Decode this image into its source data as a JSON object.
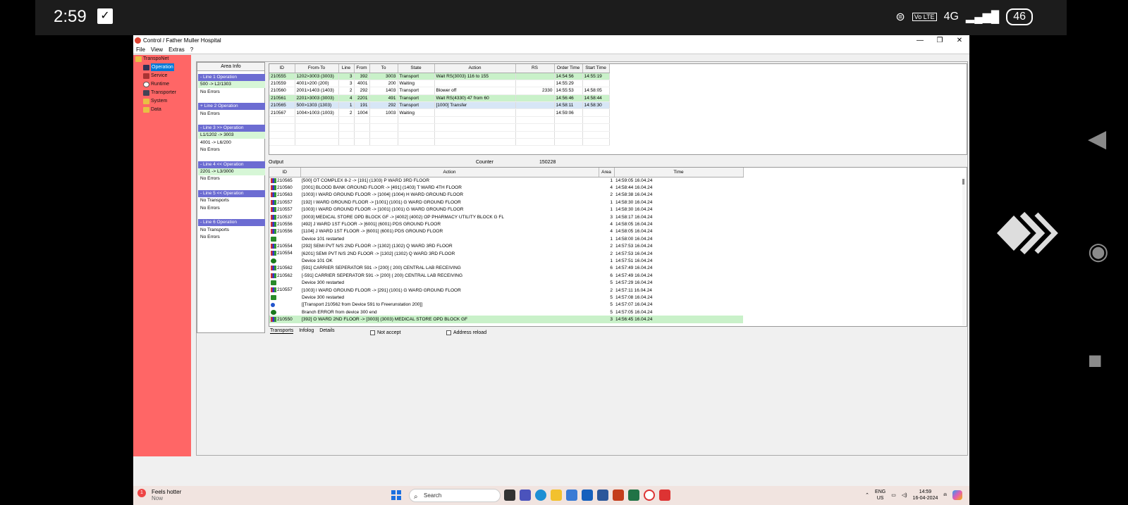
{
  "phone": {
    "time": "2:59",
    "signal": "4G",
    "volte": "Vo LTE",
    "battery": "46"
  },
  "window": {
    "title": "Control / Father Muller Hospital",
    "menus": [
      "File",
      "View",
      "Extras",
      "?"
    ],
    "min": "—",
    "max": "❐",
    "close": "✕"
  },
  "tree": [
    "TranspoNet",
    "Operation",
    "Service",
    "Runtime",
    "Transporter",
    "System",
    "Data"
  ],
  "areaInfo": {
    "header": "Area Info",
    "lines": [
      {
        "title": "- Line 1    Operation",
        "rows": [
          "500 -> L2/1303",
          "No Errors"
        ]
      },
      {
        "title": "+ Line 2    Operation",
        "rows": [
          "No Errors"
        ]
      },
      {
        "title": "- Line 3  >> Operation",
        "rows": [
          "L1/1202 -> 3003",
          "4001 -> L6/200",
          "No Errors"
        ]
      },
      {
        "title": "- Line 4   << Operation",
        "rows": [
          "2201 -> L3/3000",
          "No Errors"
        ]
      },
      {
        "title": "- Line 5   << Operation",
        "rows": [
          "No Transports",
          "No Errors"
        ]
      },
      {
        "title": "- Line 6    Operation",
        "rows": [
          "No Transports",
          "No Errors"
        ]
      }
    ]
  },
  "transports": {
    "columns": [
      "ID",
      "From-To",
      "Line",
      "From",
      "To",
      "State",
      "Action",
      "RS",
      "Order Time",
      "Start Time"
    ],
    "rows": [
      {
        "style": "g",
        "cells": [
          "210555",
          "1202>3003 (3003)",
          "3",
          "392",
          "3003",
          "Transport",
          "Wait RS(3003) 116 to 155",
          "",
          "14:54:56",
          "14:55:19"
        ]
      },
      {
        "style": "",
        "cells": [
          "210559",
          "4001>200 (200)",
          "3",
          "4001",
          "200",
          "Waiting",
          "",
          "",
          "14:55:29",
          ""
        ]
      },
      {
        "style": "",
        "cells": [
          "210560",
          "2001>1403 (1403)",
          "2",
          "292",
          "1403",
          "Transport",
          "Blower off",
          "2330",
          "14:55:53",
          "14:58:05"
        ]
      },
      {
        "style": "g",
        "cells": [
          "210561",
          "2201>3003 (3003)",
          "4",
          "2201",
          "491",
          "Transport",
          "Wait RS(4330) 47 from 60",
          "",
          "14:56:46",
          "14:58:44"
        ]
      },
      {
        "style": "b",
        "cells": [
          "210565",
          "500>1303 (1303)",
          "1",
          "191",
          "292",
          "Transport",
          "[1000] Transfer",
          "",
          "14:58:11",
          "14:58:30"
        ]
      },
      {
        "style": "",
        "cells": [
          "210567",
          "1004>1003 (1003)",
          "2",
          "1004",
          "1003",
          "Waiting",
          "",
          "",
          "14:59:06",
          ""
        ]
      }
    ]
  },
  "output": {
    "label": "Output",
    "counterLabel": "Counter",
    "counterValue": "150228"
  },
  "log": {
    "columns": [
      "ID",
      "Action",
      "Area",
      "Time"
    ],
    "rows": [
      {
        "icon": "tr",
        "id": "210565",
        "action": "[500] OT COMPLEX 8-2   -> [191] (1303) P  WARD 3RD FLOOR",
        "area": "1",
        "time": "14:59:05  16.04.24",
        "style": ""
      },
      {
        "icon": "tr",
        "id": "210560",
        "action": "[2001] BLOOD BANK GROUND FLOOR -> [491] (1403) T  WARD 4TH FLOOR",
        "area": "4",
        "time": "14:58:44  16.04.24",
        "style": ""
      },
      {
        "icon": "tr",
        "id": "210563",
        "action": "[1003] I WARD GROUND FLOOR -> [1004] (1004) H WARD GROUND FLOOR",
        "area": "2",
        "time": "14:58:38  16.04.24",
        "style": ""
      },
      {
        "icon": "tr",
        "id": "210557",
        "action": "[192] I WARD GROUND FLOOR -> [1001] (1001) G WARD GROUND FLOOR",
        "area": "1",
        "time": "14:58:30  16.04.24",
        "style": ""
      },
      {
        "icon": "tr",
        "id": "210557",
        "action": "[1003] I WARD GROUND FLOOR -> [1001] (1001) G WARD GROUND FLOOR",
        "area": "1",
        "time": "14:58:30  16.04.24",
        "style": ""
      },
      {
        "icon": "tr",
        "id": "210537",
        "action": "[3003] MEDICAL STORE OPD BLOCK GF -> [4002] (4002) OP PHARMACY UTILITY BLOCK G FL",
        "area": "3",
        "time": "14:58:17  16.04.24",
        "style": ""
      },
      {
        "icon": "tr",
        "id": "210556",
        "action": "[492] J WARD 1ST FLOOR -> [6001] (6001) PDS GROUND FLOOR",
        "area": "4",
        "time": "14:58:05  16.04.24",
        "style": ""
      },
      {
        "icon": "tr",
        "id": "210556",
        "action": "[1104] J WARD 1ST FLOOR -> [6001] (6001) PDS GROUND FLOOR",
        "area": "4",
        "time": "14:58:05  16.04.24",
        "style": ""
      },
      {
        "icon": "ok",
        "id": "",
        "action": "Device 101 restarted",
        "area": "1",
        "time": "14:58:00  16.04.24",
        "style": ""
      },
      {
        "icon": "tr",
        "id": "210554",
        "action": "[292] SEMI PVT N/S 2ND FLOOR -> [1302] (1302) Q WARD 3RD FLOOR",
        "area": "2",
        "time": "14:57:53  16.04.24",
        "style": ""
      },
      {
        "icon": "tr",
        "id": "210554",
        "action": "[6201] SEMI PVT N/S 2ND FLOOR -> [1302] (1302) Q WARD 3RD FLOOR",
        "area": "2",
        "time": "14:57:53  16.04.24",
        "style": ""
      },
      {
        "icon": "err",
        "id": "",
        "action": "Device 101 OK",
        "area": "1",
        "time": "14:57:51  16.04.24",
        "style": ""
      },
      {
        "icon": "tr",
        "id": "210562",
        "action": "[591] CARRIER SEPERATOR 591 -> [200] ( 200) CENTRAL LAB RECEIVING",
        "area": "6",
        "time": "14:57:49  16.04.24",
        "style": ""
      },
      {
        "icon": "tr",
        "id": "210562",
        "action": "[-591] CARRIER SEPERATOR 591 -> [200] ( 200) CENTRAL LAB RECEIVING",
        "area": "6",
        "time": "14:57:49  16.04.24",
        "style": ""
      },
      {
        "icon": "ok",
        "id": "",
        "action": "Device 300 restarted",
        "area": "5",
        "time": "14:57:29  16.04.24",
        "style": ""
      },
      {
        "icon": "tr",
        "id": "210557",
        "action": "[1003] I WARD GROUND FLOOR -> [291] (1001) G WARD GROUND FLOOR",
        "area": "2",
        "time": "14:57:11  16.04.24",
        "style": ""
      },
      {
        "icon": "ok",
        "id": "",
        "action": "Device 300 restarted",
        "area": "5",
        "time": "14:57:08  16.04.24",
        "style": ""
      },
      {
        "icon": "info",
        "id": "",
        "action": "[[Transport 210562 from Device 591 to Freerunstation 200]]",
        "area": "5",
        "time": "14:57:07  16.04.24",
        "style": ""
      },
      {
        "icon": "err",
        "id": "",
        "action": "Branch ERROR from device 300 end",
        "area": "5",
        "time": "14:57:05  16.04.24",
        "style": ""
      },
      {
        "icon": "tr",
        "id": "210550",
        "action": "[392] O WARD 2ND FLOOR -> [3003] (3003) MEDICAL STORE OPD BLOCK GF",
        "area": "3",
        "time": "14:56:45  16.04.24",
        "style": "g"
      }
    ]
  },
  "tabs": [
    "Transports",
    "Infolog",
    "Details"
  ],
  "checks": {
    "notAccept": "Not accept",
    "addressReload": "Address reload"
  },
  "taskbar": {
    "weatherTitle": "Feels hotter",
    "weatherSub": "Now",
    "badge": "1",
    "search": "Search",
    "lang": "ENG",
    "region": "US",
    "time": "14:59",
    "date": "16-04-2024"
  },
  "colors": {
    "sidebar": "#ff6666",
    "lineHeader": "#6c6cd2",
    "greenRow": "#c9f1c9",
    "blueRow": "#d7e6f6",
    "selection": "#0078d7"
  }
}
